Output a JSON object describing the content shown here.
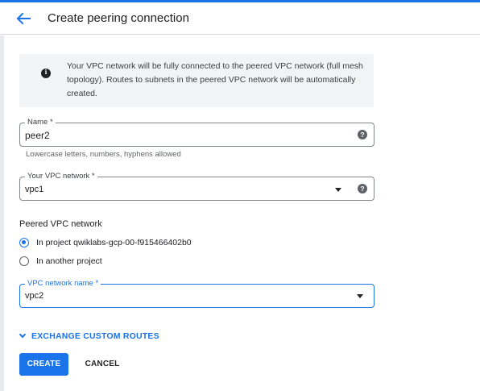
{
  "header": {
    "title": "Create peering connection",
    "back_icon": "arrow-left-icon"
  },
  "info": {
    "icon": "info-icon",
    "text": "Your VPC network will be fully connected to the peered VPC network (full mesh topology). Routes to subnets in the peered VPC network will be automatically created."
  },
  "name_field": {
    "label": "Name *",
    "value": "peer2",
    "hint": "Lowercase letters, numbers, hyphens allowed",
    "help_glyph": "?"
  },
  "your_vpc": {
    "label": "Your VPC network *",
    "value": "vpc1",
    "help_glyph": "?"
  },
  "peered": {
    "section_title": "Peered VPC network",
    "options": [
      {
        "label": "In project qwiklabs-gcp-00-f915466402b0",
        "selected": true
      },
      {
        "label": "In another project",
        "selected": false
      }
    ]
  },
  "vpc_name": {
    "label": "VPC network name *",
    "value": "vpc2"
  },
  "expand": {
    "label": "EXCHANGE CUSTOM ROUTES"
  },
  "actions": {
    "create": "CREATE",
    "cancel": "CANCEL"
  },
  "colors": {
    "accent": "#1a73e8",
    "info_bg": "#f1f3f4"
  }
}
